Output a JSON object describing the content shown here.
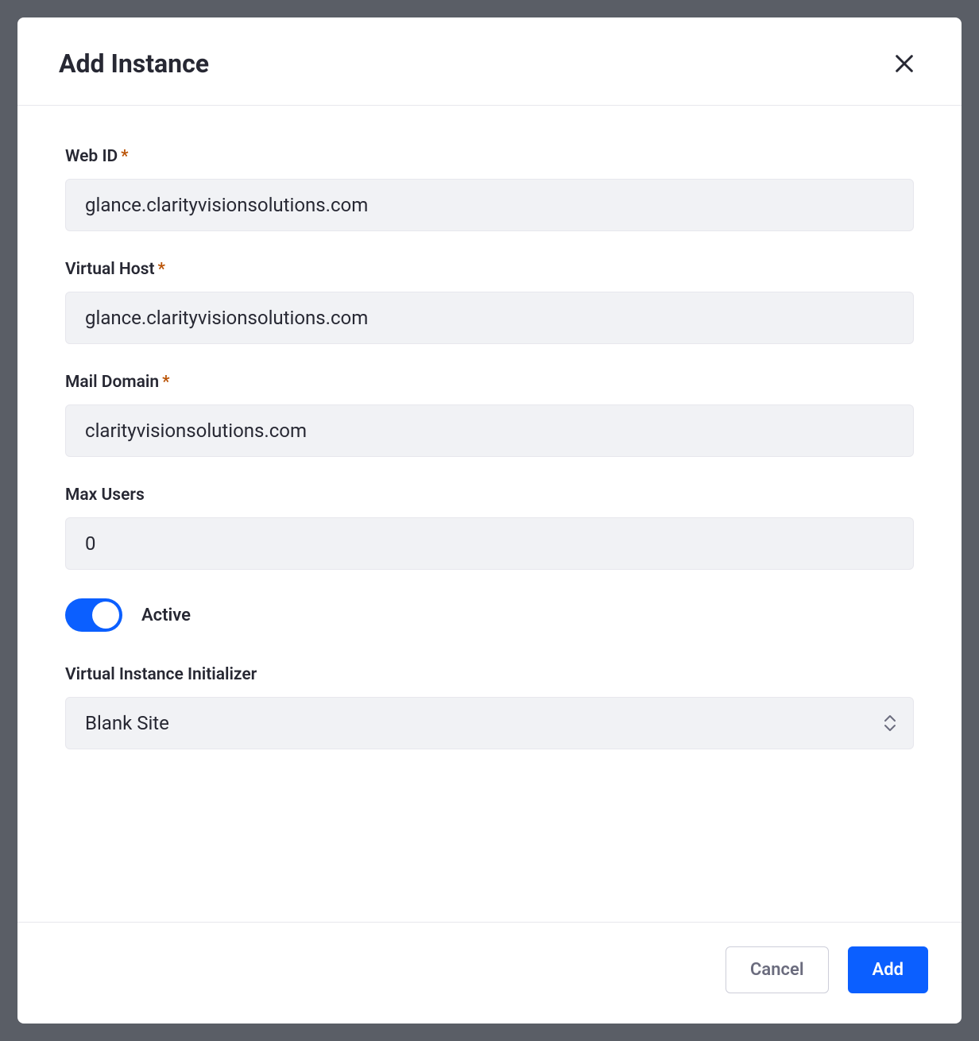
{
  "modal": {
    "title": "Add Instance"
  },
  "form": {
    "web_id": {
      "label": "Web ID",
      "required": true,
      "value": "glance.clarityvisionsolutions.com"
    },
    "virtual_host": {
      "label": "Virtual Host",
      "required": true,
      "value": "glance.clarityvisionsolutions.com"
    },
    "mail_domain": {
      "label": "Mail Domain",
      "required": true,
      "value": "clarityvisionsolutions.com"
    },
    "max_users": {
      "label": "Max Users",
      "required": false,
      "value": "0"
    },
    "active": {
      "label": "Active",
      "value": true
    },
    "initializer": {
      "label": "Virtual Instance Initializer",
      "required": false,
      "value": "Blank Site"
    }
  },
  "footer": {
    "cancel": "Cancel",
    "add": "Add"
  }
}
